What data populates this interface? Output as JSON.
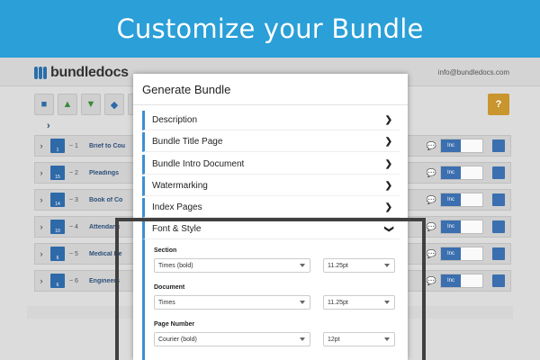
{
  "banner": {
    "title": "Customize your Bundle"
  },
  "app": {
    "logo_text": "bundledocs",
    "email": "info@bundledocs.com",
    "help_label": "?",
    "rows": [
      {
        "num": "~ 1",
        "name": "Brief to Cou",
        "badge": "1"
      },
      {
        "num": "~ 2",
        "name": "Pleadings",
        "badge": "15"
      },
      {
        "num": "~ 3",
        "name": "Book of Co",
        "badge": "14"
      },
      {
        "num": "~ 4",
        "name": "Attendanc",
        "badge": "10"
      },
      {
        "num": "~ 5",
        "name": "Medical Re",
        "badge": "6"
      },
      {
        "num": "~ 6",
        "name": "Engineers",
        "badge": "6"
      }
    ],
    "inc_label": "Inc"
  },
  "modal": {
    "title": "Generate Bundle",
    "sections": [
      {
        "label": "Description",
        "state": "collapsed"
      },
      {
        "label": "Bundle Title Page",
        "state": "collapsed"
      },
      {
        "label": "Bundle Intro Document",
        "state": "collapsed"
      },
      {
        "label": "Watermarking",
        "state": "collapsed"
      },
      {
        "label": "Index Pages",
        "state": "collapsed"
      },
      {
        "label": "Font & Style",
        "state": "expanded"
      }
    ],
    "font_style": {
      "section": {
        "label": "Section",
        "font": "Times (bold)",
        "size": "11.25pt"
      },
      "document": {
        "label": "Document",
        "font": "Times",
        "size": "11.25pt"
      },
      "page_number": {
        "label": "Page Number",
        "font": "Courier (bold)",
        "size": "12pt"
      }
    }
  },
  "icons": {
    "chevron_right": "chevron-right-icon",
    "chevron_down": "chevron-down-icon"
  },
  "colors": {
    "banner": "#2a9fd8",
    "accent": "#3d8fd1",
    "help": "#c8952e"
  }
}
